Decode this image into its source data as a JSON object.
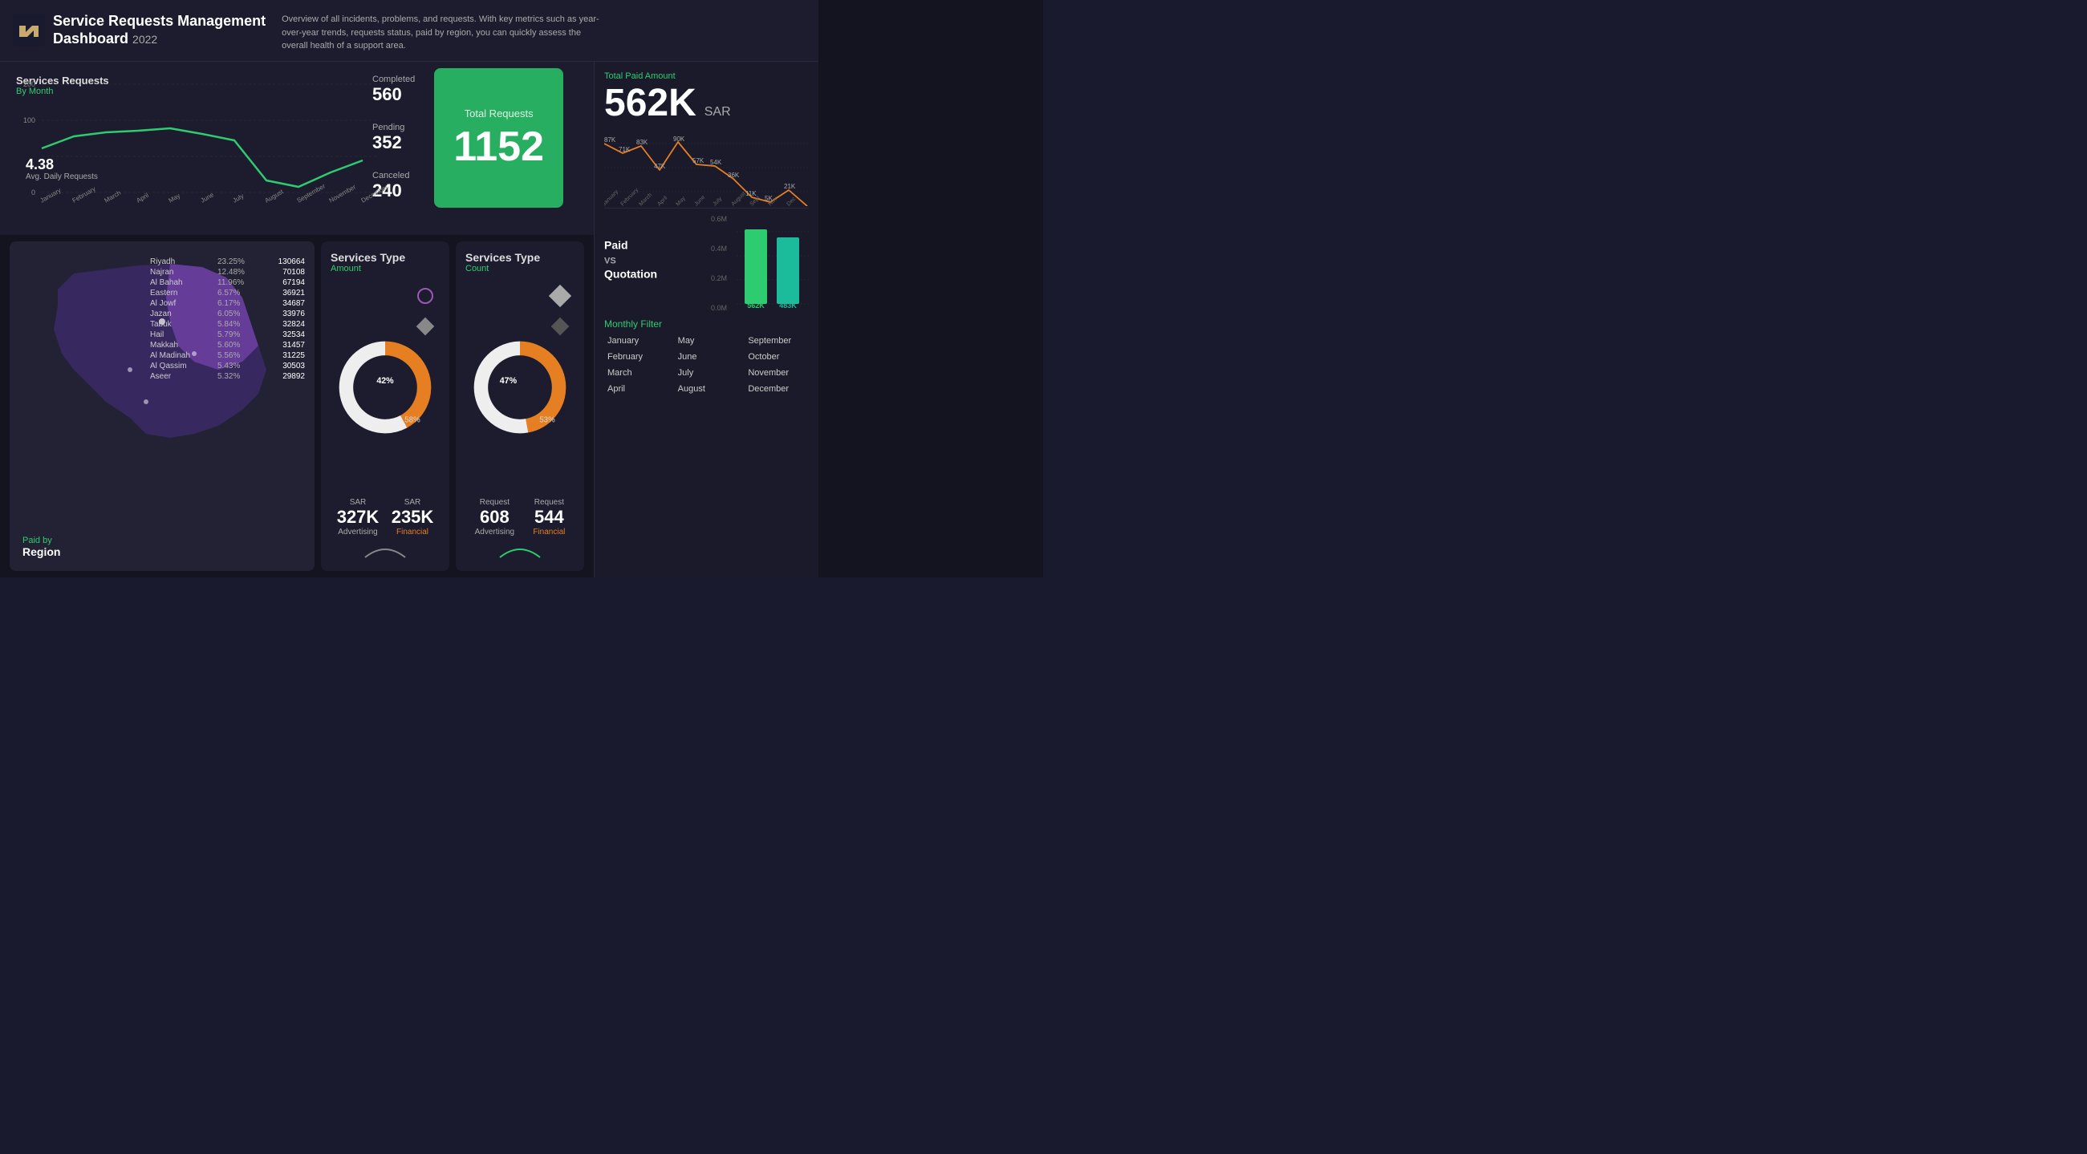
{
  "header": {
    "title": "Service Requests Management",
    "subtitle": "Dashboard",
    "year": "2022",
    "description": "Overview of all incidents, problems, and requests. With key metrics such as year-over-year trends, requests status, paid by region, you can quickly assess the overall health of a support area."
  },
  "stats": {
    "completed_label": "Completed",
    "completed_value": "560",
    "pending_label": "Pending",
    "pending_value": "352",
    "canceled_label": "Canceled",
    "canceled_value": "240",
    "total_label": "Total Requests",
    "total_value": "1152"
  },
  "line_chart": {
    "title": "Services Requests",
    "subtitle": "By Month",
    "avg_label": "Avg. Daily Requests",
    "avg_value": "4.38",
    "months": [
      "January",
      "February",
      "March",
      "April",
      "May",
      "June",
      "July",
      "August",
      "September",
      "November",
      "December"
    ]
  },
  "region_table": {
    "title": "Paid by",
    "subtitle": "Region",
    "rows": [
      {
        "name": "Riyadh",
        "pct": "23.25%",
        "val": "130664"
      },
      {
        "name": "Najran",
        "pct": "12.48%",
        "val": "70108"
      },
      {
        "name": "Al Bahah",
        "pct": "11.96%",
        "val": "67194"
      },
      {
        "name": "Eastern",
        "pct": "6.57%",
        "val": "36921"
      },
      {
        "name": "Al Jowf",
        "pct": "6.17%",
        "val": "34687"
      },
      {
        "name": "Jazan",
        "pct": "6.05%",
        "val": "33976"
      },
      {
        "name": "Tabuk",
        "pct": "5.84%",
        "val": "32824"
      },
      {
        "name": "Hail",
        "pct": "5.79%",
        "val": "32534"
      },
      {
        "name": "Makkah",
        "pct": "5.60%",
        "val": "31457"
      },
      {
        "name": "Al Madinah",
        "pct": "5.56%",
        "val": "31225"
      },
      {
        "name": "Al Qassim",
        "pct": "5.43%",
        "val": "30503"
      },
      {
        "name": "Aseer",
        "pct": "5.32%",
        "val": "29892"
      }
    ]
  },
  "services_amount": {
    "title": "Services Type",
    "subtitle": "Amount",
    "pct1": "42%",
    "pct2": "58%",
    "label1_currency": "SAR",
    "label1_value": "327K",
    "label1_name": "Advertising",
    "label2_currency": "SAR",
    "label2_value": "235K",
    "label2_name": "Financial"
  },
  "services_count": {
    "title": "Services Type",
    "subtitle": "Count",
    "pct1": "47%",
    "pct2": "53%",
    "label1_prefix": "Request",
    "label1_value": "608",
    "label1_name": "Advertising",
    "label2_prefix": "Request",
    "label2_value": "544",
    "label2_name": "Financial"
  },
  "sidebar": {
    "total_paid_label": "Total Paid Amount",
    "total_paid_value": "562K",
    "total_paid_unit": "SAR",
    "sparkline_months": [
      "January",
      "February",
      "March",
      "April",
      "May",
      "June",
      "July",
      "August",
      "September",
      "October",
      "November",
      "December"
    ],
    "sparkline_values": [
      87,
      71,
      83,
      47,
      90,
      57,
      54,
      36,
      11,
      5,
      21,
      0
    ],
    "paid_label": "Paid",
    "vs_label": "VS",
    "quotation_label": "Quotation",
    "paid_bar_value": "562K",
    "quotation_bar_value": "483K",
    "y_labels": [
      "0.6M",
      "0.4M",
      "0.2M",
      "0.0M"
    ],
    "monthly_filter_label": "Monthly Filter",
    "months": [
      [
        "January",
        "May",
        "September"
      ],
      [
        "February",
        "June",
        "October"
      ],
      [
        "March",
        "July",
        "November"
      ],
      [
        "April",
        "August",
        "December"
      ]
    ]
  },
  "colors": {
    "green": "#2ecc71",
    "orange": "#e67e22",
    "purple": "#8e44ad",
    "bg_dark": "#141420",
    "bg_card": "#1c1c2e",
    "accent": "#27ae60"
  }
}
